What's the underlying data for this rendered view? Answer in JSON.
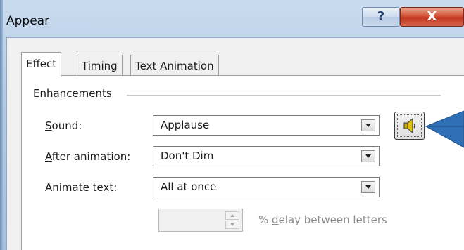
{
  "window": {
    "title": "Appear",
    "help_glyph": "?",
    "close_glyph": "X"
  },
  "tabs": [
    {
      "label": "Effect",
      "active": true
    },
    {
      "label": "Timing",
      "active": false
    },
    {
      "label": "Text Animation",
      "active": false
    }
  ],
  "enhancements": {
    "group_label": "Enhancements",
    "sound": {
      "label_prefix": "",
      "label_mnemonic": "S",
      "label_rest": "ound:",
      "value": "Applause"
    },
    "after_animation": {
      "label_prefix": "",
      "label_mnemonic": "A",
      "label_rest": "fter animation:",
      "value": "Don't Dim"
    },
    "animate_text": {
      "label_prefix": "Animate te",
      "label_mnemonic": "x",
      "label_rest": "t:",
      "value": "All at once"
    },
    "delay": {
      "value": "",
      "label_prefix": "% ",
      "label_mnemonic": "d",
      "label_rest": "elay between letters",
      "enabled": false
    }
  },
  "icons": {
    "help": "question-mark-icon",
    "close": "close-icon",
    "sound_preview": "speaker-icon",
    "callout": "blue-arrow-annotation"
  },
  "colors": {
    "frame": "#b5cbe4",
    "close": "#c2371f",
    "callout": "#2f6fb6",
    "speaker": "#c8a700"
  }
}
